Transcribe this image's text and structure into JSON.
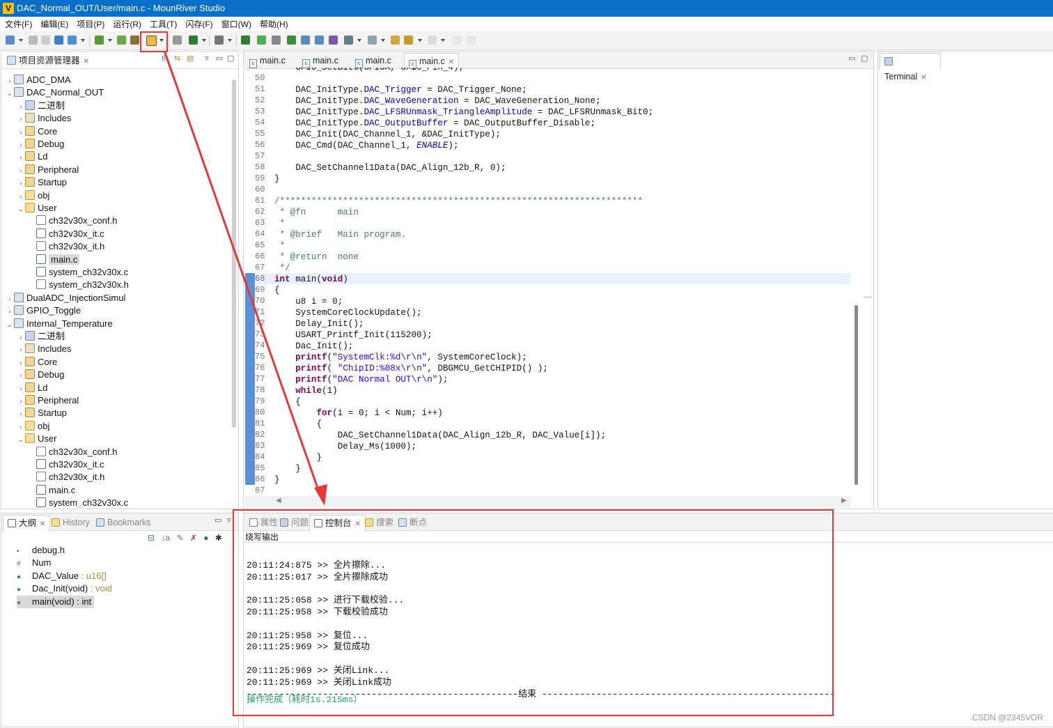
{
  "window": {
    "title": "DAC_Normal_OUT/User/main.c - MounRiver Studio"
  },
  "menu": [
    "文件(F)",
    "编辑(E)",
    "项目(P)",
    "运行(R)",
    "工具(T)",
    "闪存(F)",
    "窗口(W)",
    "帮助(H)"
  ],
  "project_explorer": {
    "title": "项目资源管理器",
    "items": [
      {
        "label": "ADC_DMA",
        "arrow": ">",
        "icon": "project-icon",
        "depth": 0
      },
      {
        "label": "DAC_Normal_OUT",
        "arrow": "v",
        "icon": "project-icon",
        "depth": 0
      },
      {
        "label": "二进制",
        "arrow": ">",
        "icon": "binaries-icon",
        "depth": 1
      },
      {
        "label": "Includes",
        "arrow": ">",
        "icon": "includes-icon",
        "depth": 1
      },
      {
        "label": "Core",
        "arrow": ">",
        "icon": "source-folder-icon",
        "depth": 1
      },
      {
        "label": "Debug",
        "arrow": ">",
        "icon": "source-folder-icon",
        "depth": 1
      },
      {
        "label": "Ld",
        "arrow": ">",
        "icon": "source-folder-icon",
        "depth": 1
      },
      {
        "label": "Peripheral",
        "arrow": ">",
        "icon": "source-folder-icon",
        "depth": 1
      },
      {
        "label": "Startup",
        "arrow": ">",
        "icon": "source-folder-icon",
        "depth": 1
      },
      {
        "label": "obj",
        "arrow": ">",
        "icon": "folder-icon",
        "depth": 1
      },
      {
        "label": "User",
        "arrow": "v",
        "icon": "folder-icon",
        "depth": 1
      },
      {
        "label": "ch32v30x_conf.h",
        "arrow": "",
        "icon": "h-file-icon",
        "depth": 2
      },
      {
        "label": "ch32v30x_it.c",
        "arrow": "",
        "icon": "c-file-icon",
        "depth": 2
      },
      {
        "label": "ch32v30x_it.h",
        "arrow": "",
        "icon": "h-file-icon",
        "depth": 2
      },
      {
        "label": "main.c",
        "arrow": "",
        "icon": "c-file-icon",
        "depth": 2,
        "selected": true
      },
      {
        "label": "system_ch32v30x.c",
        "arrow": "",
        "icon": "c-file-icon",
        "depth": 2
      },
      {
        "label": "system_ch32v30x.h",
        "arrow": "",
        "icon": "h-file-icon",
        "depth": 2
      },
      {
        "label": "DualADC_InjectionSimul",
        "arrow": ">",
        "icon": "project-icon",
        "depth": 0
      },
      {
        "label": "GPIO_Toggle",
        "arrow": ">",
        "icon": "project-icon",
        "depth": 0
      },
      {
        "label": "Internal_Temperature",
        "arrow": "v",
        "icon": "project-icon",
        "depth": 0
      },
      {
        "label": "二进制",
        "arrow": ">",
        "icon": "binaries-icon",
        "depth": 1
      },
      {
        "label": "Includes",
        "arrow": ">",
        "icon": "includes-icon",
        "depth": 1
      },
      {
        "label": "Core",
        "arrow": ">",
        "icon": "source-folder-icon",
        "depth": 1
      },
      {
        "label": "Debug",
        "arrow": ">",
        "icon": "source-folder-icon",
        "depth": 1
      },
      {
        "label": "Ld",
        "arrow": ">",
        "icon": "source-folder-icon",
        "depth": 1
      },
      {
        "label": "Peripheral",
        "arrow": ">",
        "icon": "source-folder-icon",
        "depth": 1
      },
      {
        "label": "Startup",
        "arrow": ">",
        "icon": "source-folder-icon",
        "depth": 1
      },
      {
        "label": "obj",
        "arrow": ">",
        "icon": "folder-icon",
        "depth": 1
      },
      {
        "label": "User",
        "arrow": "v",
        "icon": "folder-icon",
        "depth": 1
      },
      {
        "label": "ch32v30x_conf.h",
        "arrow": "",
        "icon": "h-file-icon",
        "depth": 2
      },
      {
        "label": "ch32v30x_it.c",
        "arrow": "",
        "icon": "c-file-icon",
        "depth": 2
      },
      {
        "label": "ch32v30x_it.h",
        "arrow": "",
        "icon": "h-file-icon",
        "depth": 2
      },
      {
        "label": "main.c",
        "arrow": "",
        "icon": "c-file-icon",
        "depth": 2
      },
      {
        "label": "system_ch32v30x.c",
        "arrow": "",
        "icon": "c-file-icon",
        "depth": 2
      }
    ]
  },
  "editor": {
    "tabs": [
      {
        "label": "main.c",
        "active": false
      },
      {
        "label": "main.c",
        "active": false
      },
      {
        "label": "main.c",
        "active": false
      },
      {
        "label": "main.c",
        "active": true
      }
    ],
    "lines": [
      {
        "n": "50",
        "code": ""
      },
      {
        "n": "51",
        "code": "    DAC_InitType.DAC_Trigger = DAC_Trigger_None;"
      },
      {
        "n": "52",
        "code": "    DAC_InitType.DAC_WaveGeneration = DAC_WaveGeneration_None;"
      },
      {
        "n": "53",
        "code": "    DAC_InitType.DAC_LFSRUnmask_TriangleAmplitude = DAC_LFSRUnmask_Bit0;"
      },
      {
        "n": "54",
        "code": "    DAC_InitType.DAC_OutputBuffer = DAC_OutputBuffer_Disable;"
      },
      {
        "n": "55",
        "code": "    DAC_Init(DAC_Channel_1, &DAC_InitType);"
      },
      {
        "n": "56",
        "code": "    DAC_Cmd(DAC_Channel_1, ENABLE);"
      },
      {
        "n": "57",
        "code": ""
      },
      {
        "n": "58",
        "code": "    DAC_SetChannel1Data(DAC_Align_12b_R, 0);"
      },
      {
        "n": "59",
        "code": "}"
      },
      {
        "n": "60",
        "code": ""
      },
      {
        "n": "61",
        "code": "/*********************************************************************"
      },
      {
        "n": "62",
        "code": " * @fn      main"
      },
      {
        "n": "63",
        "code": " *"
      },
      {
        "n": "64",
        "code": " * @brief   Main program."
      },
      {
        "n": "65",
        "code": " *"
      },
      {
        "n": "66",
        "code": " * @return  none"
      },
      {
        "n": "67",
        "code": " */"
      },
      {
        "n": "68",
        "code": "int main(void)"
      },
      {
        "n": "69",
        "code": "{"
      },
      {
        "n": "70",
        "code": "    u8 i = 0;"
      },
      {
        "n": "71",
        "code": "    SystemCoreClockUpdate();"
      },
      {
        "n": "72",
        "code": "    Delay_Init();"
      },
      {
        "n": "73",
        "code": "    USART_Printf_Init(115200);"
      },
      {
        "n": "74",
        "code": "    Dac_Init();"
      },
      {
        "n": "75",
        "code": "    printf(\"SystemClk:%d\\r\\n\", SystemCoreClock);"
      },
      {
        "n": "76",
        "code": "    printf( \"ChipID:%08x\\r\\n\", DBGMCU_GetCHIPID() );"
      },
      {
        "n": "77",
        "code": "    printf(\"DAC Normal OUT\\r\\n\");"
      },
      {
        "n": "78",
        "code": "    while(1)"
      },
      {
        "n": "79",
        "code": "    {"
      },
      {
        "n": "80",
        "code": "        for(i = 0; i < Num; i++)"
      },
      {
        "n": "81",
        "code": "        {"
      },
      {
        "n": "82",
        "code": "            DAC_SetChannel1Data(DAC_Align_12b_R, DAC_Value[i]);"
      },
      {
        "n": "83",
        "code": "            Delay_Ms(1000);"
      },
      {
        "n": "84",
        "code": "        }"
      },
      {
        "n": "85",
        "code": "    }"
      },
      {
        "n": "86",
        "code": "}"
      },
      {
        "n": "87",
        "code": ""
      }
    ]
  },
  "terminal": {
    "tab_label": "Terminal"
  },
  "outline": {
    "tabs": [
      {
        "label": "大纲",
        "active": true
      },
      {
        "label": "History",
        "active": false
      },
      {
        "label": "Bookmarks",
        "active": false
      }
    ],
    "items": [
      {
        "name": "debug.h",
        "type": "",
        "icon": "include-icon"
      },
      {
        "name": "Num",
        "type": "",
        "icon": "macro-icon"
      },
      {
        "name": "DAC_Value",
        "type": " : u16[]",
        "icon": "variable-icon"
      },
      {
        "name": "Dac_Init(void)",
        "type": " : void",
        "icon": "function-icon"
      },
      {
        "name": "main(void) : int",
        "type": "",
        "icon": "function-icon",
        "selected": true
      }
    ]
  },
  "console": {
    "tabs": [
      {
        "label": "属性",
        "active": false
      },
      {
        "label": "问题",
        "active": false
      },
      {
        "label": "控制台",
        "active": true
      },
      {
        "label": "搜索",
        "active": false
      },
      {
        "label": "断点",
        "active": false
      }
    ],
    "header": "烧写输出",
    "lines": [
      "",
      "20:11:24:875 >> 全片擦除...",
      "20:11:25:017 >> 全片擦除成功",
      "",
      "20:11:25:058 >> 进行下载校验...",
      "20:11:25:958 >> 下载校验成功",
      "",
      "20:11:25:958 >> 复位...",
      "20:11:25:969 >> 复位成功",
      "",
      "20:11:25:969 >> 关闭Link...",
      "20:11:25:969 >> 关闭Link成功",
      "--------------------------------------------------结束 ------------------------------------------------------"
    ],
    "done_text": "操作完成（耗时1s.215ms）"
  },
  "watermark": "CSDN @2345VOR",
  "colors": {
    "titlebar": "#0a6fc9",
    "annotation_red": "#e53935",
    "done_green": "#26a269"
  }
}
